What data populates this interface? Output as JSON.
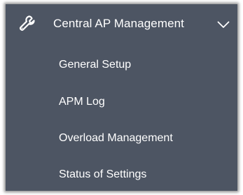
{
  "menu": {
    "header": {
      "icon": "wrench-icon",
      "label": "Central AP Management",
      "expand_icon": "chevron-down-icon"
    },
    "items": [
      {
        "label": "General Setup"
      },
      {
        "label": "APM Log"
      },
      {
        "label": "Overload Management"
      },
      {
        "label": "Status of Settings"
      }
    ]
  },
  "colors": {
    "panel_background": "#4d5563",
    "text": "#ffffff",
    "page_background": "#ffffff"
  }
}
